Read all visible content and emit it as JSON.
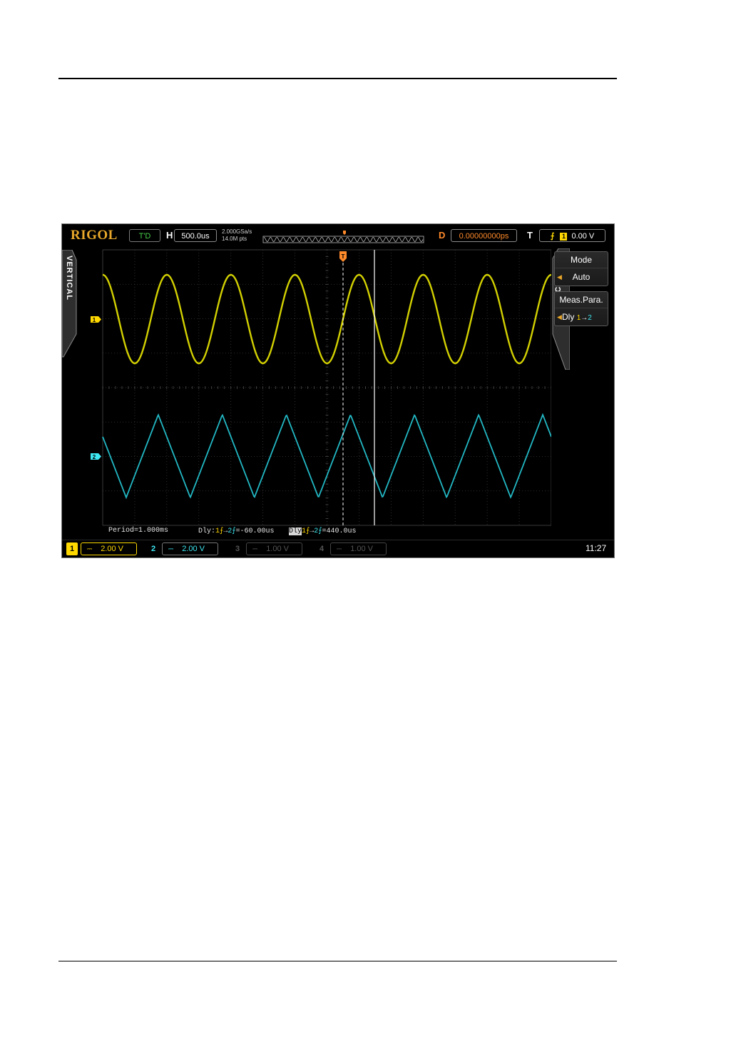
{
  "scope": {
    "logo": "RIGOL",
    "status": "T'D",
    "timebase_label": "H",
    "timebase": "500.0us",
    "sample_rate": "2.000GSa/s",
    "memory_depth": "14.0M pts",
    "delay_label": "D",
    "delay": "0.00000000ps",
    "trigger_label": "T",
    "trigger_edge": "⨍",
    "trigger_source": "1",
    "trigger_level": "0.00 V",
    "vertical_tab": "VERTICAL",
    "cursor_tab": "CURSOR",
    "ch1_marker": "1",
    "ch2_marker": "2",
    "trigger_marker": "T"
  },
  "menu": {
    "mode_title": "Mode",
    "mode_value": "Auto",
    "meas_title": "Meas.Para.",
    "meas_value_prefix": "Dly",
    "meas_value_from": "1",
    "meas_value_arrow": "→",
    "meas_value_to": "2"
  },
  "measurements": {
    "period": "Period=1.000ms",
    "dly1_label": "Dly:",
    "dly1_edge1": "1⨍",
    "dly1_arrow": "→",
    "dly1_edge2": "2⨍",
    "dly1_value": "=-60.00us",
    "dly2_label": "Dly",
    "dly2_edge1": "1⨍",
    "dly2_arrow": "→",
    "dly2_edge2": "2⨍",
    "dly2_value": "=440.0us"
  },
  "channels": [
    {
      "num": "1",
      "coupling": "⎓",
      "scale": "2.00 V"
    },
    {
      "num": "2",
      "coupling": "⎓",
      "scale": "2.00 V"
    },
    {
      "num": "3",
      "coupling": "⎓",
      "scale": "1.00 V"
    },
    {
      "num": "4",
      "coupling": "⎓",
      "scale": "1.00 V"
    }
  ],
  "clock": "11:27",
  "colors": {
    "ch1": "#ffd800",
    "ch2": "#3ee8f2",
    "accent": "#e8a72a",
    "delay": "#ff8a2a"
  },
  "chart_data": {
    "type": "line",
    "series": [
      {
        "name": "1",
        "shape": "sine",
        "period_ms": 1.0,
        "volts_per_div": 2.0
      },
      {
        "name": "2",
        "shape": "triangle",
        "period_ms": 1.0,
        "volts_per_div": 2.0
      }
    ],
    "time_per_div_us": 500.0,
    "grid": true
  }
}
